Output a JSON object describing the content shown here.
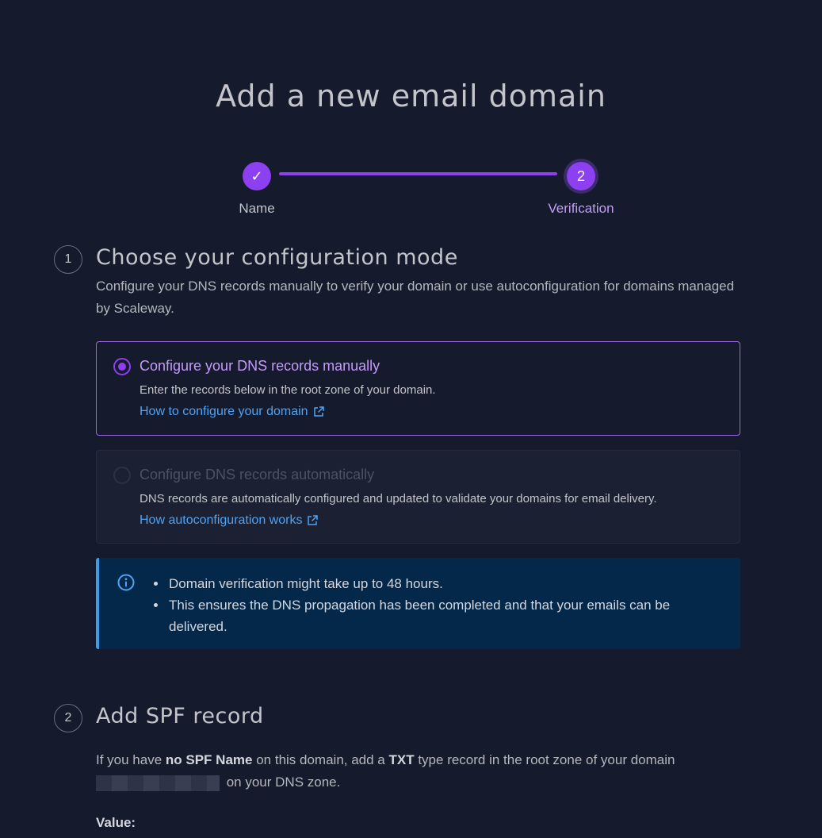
{
  "page": {
    "title": "Add a new email domain"
  },
  "stepper": {
    "steps": [
      {
        "label": "Name",
        "state": "completed",
        "marker": "✓"
      },
      {
        "label": "Verification",
        "state": "active",
        "marker": "2"
      }
    ],
    "active_color": "#8c40ef"
  },
  "section1": {
    "number": "1",
    "title": "Choose your configuration mode",
    "description": "Configure your DNS records manually to verify your domain or use autoconfiguration for domains managed by Scaleway."
  },
  "options": [
    {
      "title": "Configure your DNS records manually",
      "description": "Enter the records below in the root zone of your domain.",
      "link": "How to configure your domain",
      "selected": true,
      "disabled": false
    },
    {
      "title": "Configure DNS records automatically",
      "description": "DNS records are automatically configured and updated to validate your domains for email delivery.",
      "link": "How autoconfiguration works",
      "selected": false,
      "disabled": true
    }
  ],
  "info": {
    "icon": "info-icon",
    "items": [
      "Domain verification might take up to 48 hours.",
      "This ensures the DNS propagation has been completed and that your emails can be delivered."
    ]
  },
  "section2": {
    "number": "2",
    "title": "Add SPF record",
    "desc_part1": "If you have ",
    "desc_bold1": "no SPF Name",
    "desc_part2": " on this domain, add a ",
    "desc_bold2": "TXT",
    "desc_part3": " type record in the root zone of your domain",
    "desc_part4": " on your DNS zone.",
    "value_label": "Value:"
  },
  "colors": {
    "background": "#151a2d",
    "accent": "#8c40ef",
    "link": "#4ea3f5",
    "info_bg": "#03284a"
  }
}
